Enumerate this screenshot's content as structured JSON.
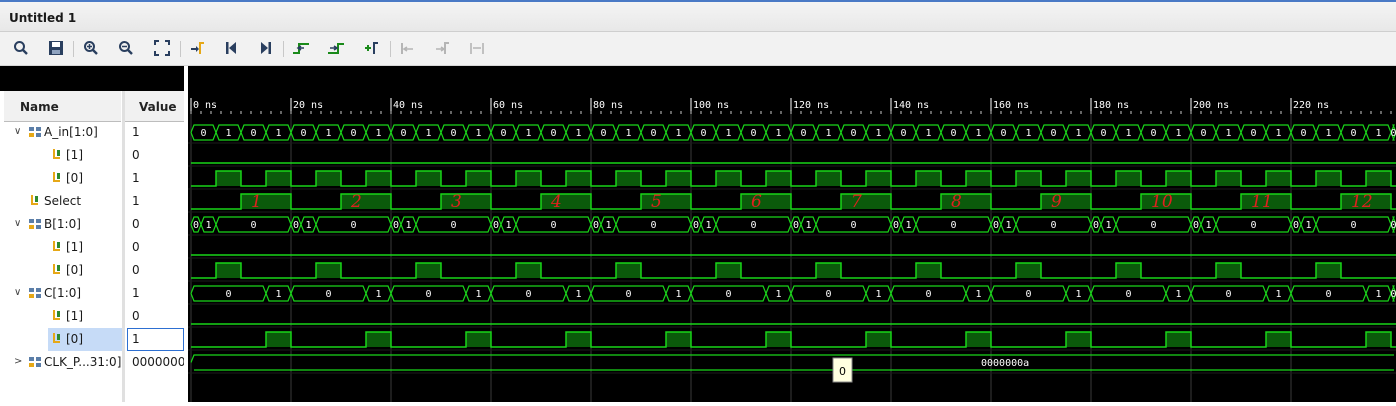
{
  "window": {
    "title": "Untitled 1"
  },
  "toolbar": {
    "buttons": [
      {
        "icon": "search-icon"
      },
      {
        "icon": "save-icon"
      },
      {
        "icon": "zoom-in-icon"
      },
      {
        "icon": "zoom-out-icon"
      },
      {
        "icon": "zoom-fit-icon"
      },
      {
        "icon": "go-to-cursor-icon"
      },
      {
        "icon": "go-to-time-0-icon"
      },
      {
        "icon": "go-to-last-time-icon"
      },
      {
        "icon": "previous-transition-icon"
      },
      {
        "icon": "next-transition-icon"
      },
      {
        "icon": "add-marker-icon"
      },
      {
        "icon": "previous-marker-icon"
      },
      {
        "icon": "next-marker-icon"
      },
      {
        "icon": "swap-cursors-icon"
      }
    ]
  },
  "columns": {
    "name": "Name",
    "value": "Value"
  },
  "signals": [
    {
      "name": "A_in[1:0]",
      "value": "1",
      "kind": "bus",
      "expanded": true
    },
    {
      "name": "[1]",
      "value": "0",
      "kind": "bit"
    },
    {
      "name": "[0]",
      "value": "1",
      "kind": "bit"
    },
    {
      "name": "Select",
      "value": "1",
      "kind": "bit"
    },
    {
      "name": "B[1:0]",
      "value": "0",
      "kind": "bus",
      "expanded": true
    },
    {
      "name": "[1]",
      "value": "0",
      "kind": "bit"
    },
    {
      "name": "[0]",
      "value": "0",
      "kind": "bit"
    },
    {
      "name": "C[1:0]",
      "value": "1",
      "kind": "bus",
      "expanded": true
    },
    {
      "name": "[1]",
      "value": "0",
      "kind": "bit"
    },
    {
      "name": "[0]",
      "value": "1",
      "kind": "bit",
      "selected": true
    },
    {
      "name": "CLK_P...31:0]",
      "value": "0000000a",
      "kind": "bus",
      "expanded": false
    }
  ],
  "timeline": {
    "tick_labels": [
      "0 ns",
      "20 ns",
      "40 ns",
      "60 ns",
      "80 ns",
      "100 ns",
      "120 ns",
      "140 ns",
      "160 ns",
      "180 ns",
      "200 ns",
      "220 ns"
    ],
    "ns_per_tick": 20
  },
  "waveforms": {
    "a_in_pattern": [
      "0",
      "1",
      "0",
      "1"
    ],
    "b_pattern": [
      "0",
      "1",
      "0"
    ],
    "c_pattern": [
      "0",
      "1"
    ],
    "clk_period_value": "0000000a",
    "tooltip": "0"
  },
  "annotations": [
    "1",
    "2",
    "3",
    "4",
    "5",
    "6",
    "7",
    "8",
    "9",
    "10",
    "11",
    "12"
  ],
  "colors": {
    "wave": "#19d619",
    "wave_fill": "#0b5a0b",
    "background": "#000000",
    "grid": "#3a3a3a",
    "annotation": "#e0201e",
    "text": "#ffffff"
  }
}
